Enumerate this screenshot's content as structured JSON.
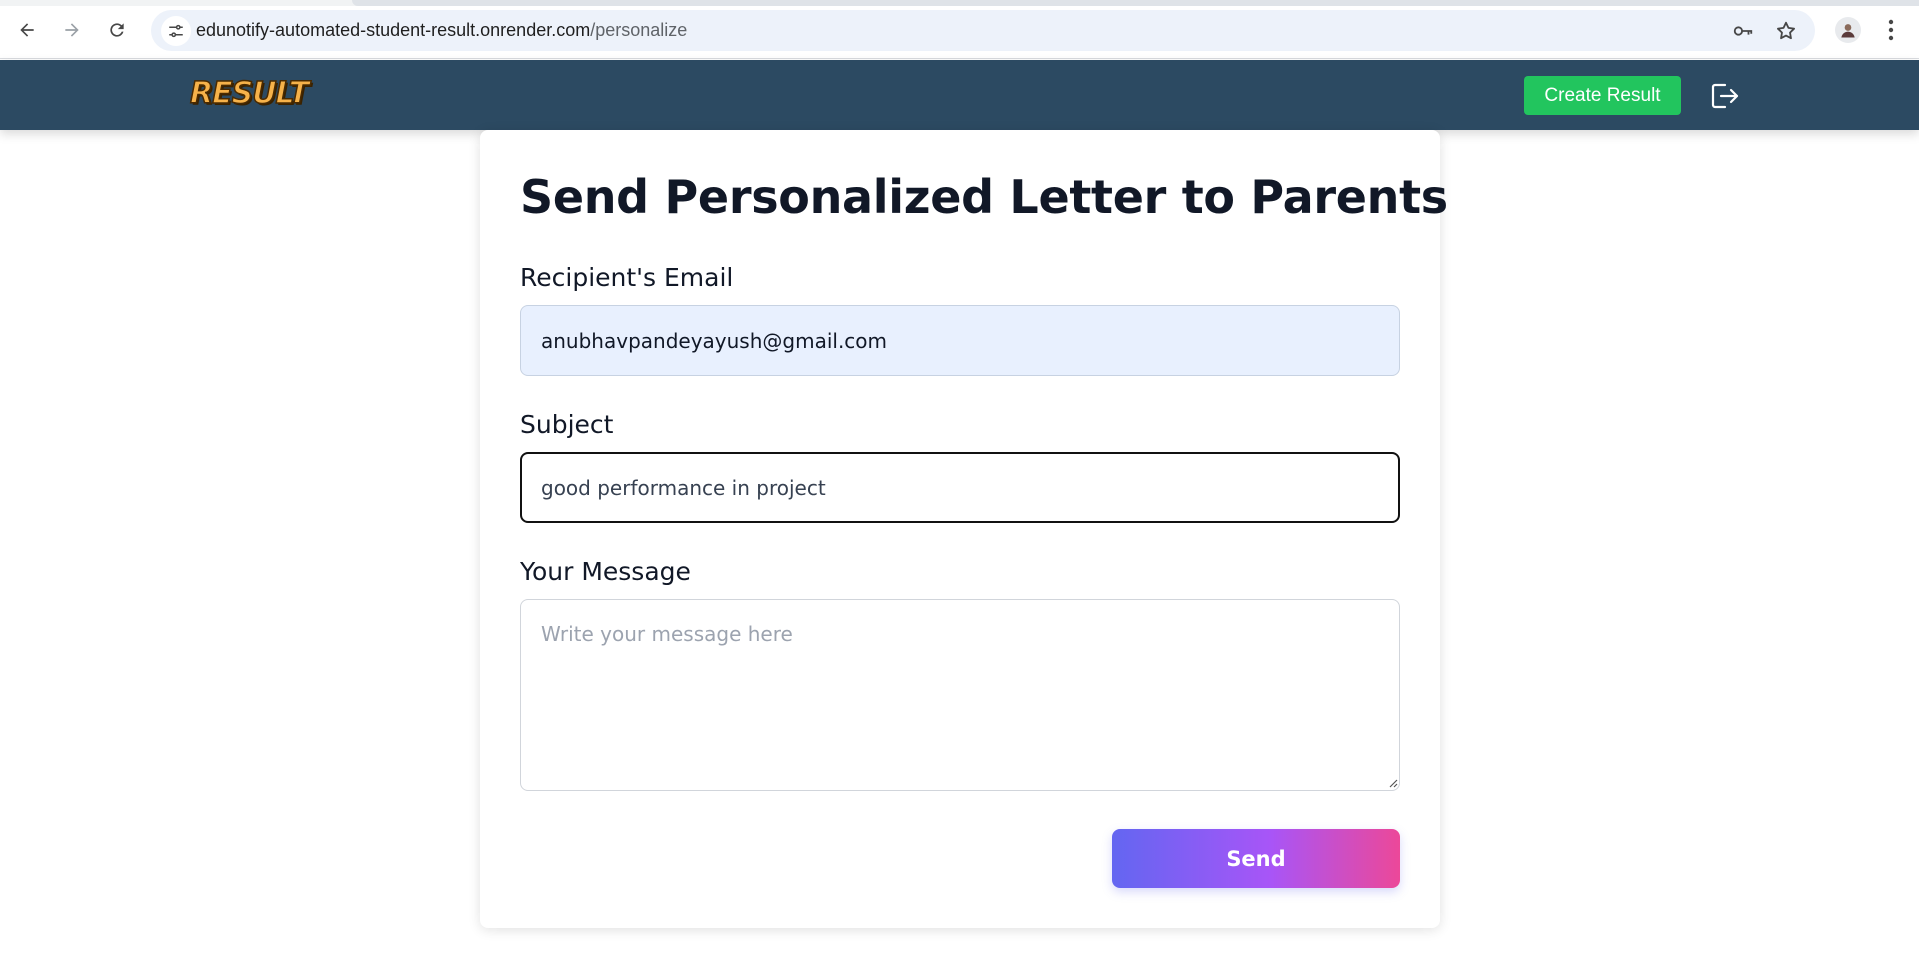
{
  "browser": {
    "url_host": "edunotify-automated-student-result.onrender.com",
    "url_path": "/personalize"
  },
  "navbar": {
    "logo_text": "RESULT",
    "create_button_label": "Create Result"
  },
  "form": {
    "title": "Send Personalized Letter to Parents",
    "email_label": "Recipient's Email",
    "email_value": "anubhavpandeyayush@gmail.com",
    "subject_label": "Subject",
    "subject_value": "good performance in project",
    "message_label": "Your Message",
    "message_placeholder": "Write your message here",
    "send_label": "Send"
  },
  "colors": {
    "navbar_bg": "#2c4a62",
    "create_button": "#22c55e",
    "send_gradient_start": "#6366f1",
    "send_gradient_end": "#ec4899",
    "email_field_bg": "#e8f0fe"
  },
  "icons": {
    "back": "arrow-left-icon",
    "forward": "arrow-right-icon",
    "reload": "reload-icon",
    "site_info": "tune-icon",
    "password": "key-icon",
    "bookmark": "star-icon",
    "profile": "avatar",
    "menu": "more-vert-icon",
    "logout": "logout-icon"
  }
}
